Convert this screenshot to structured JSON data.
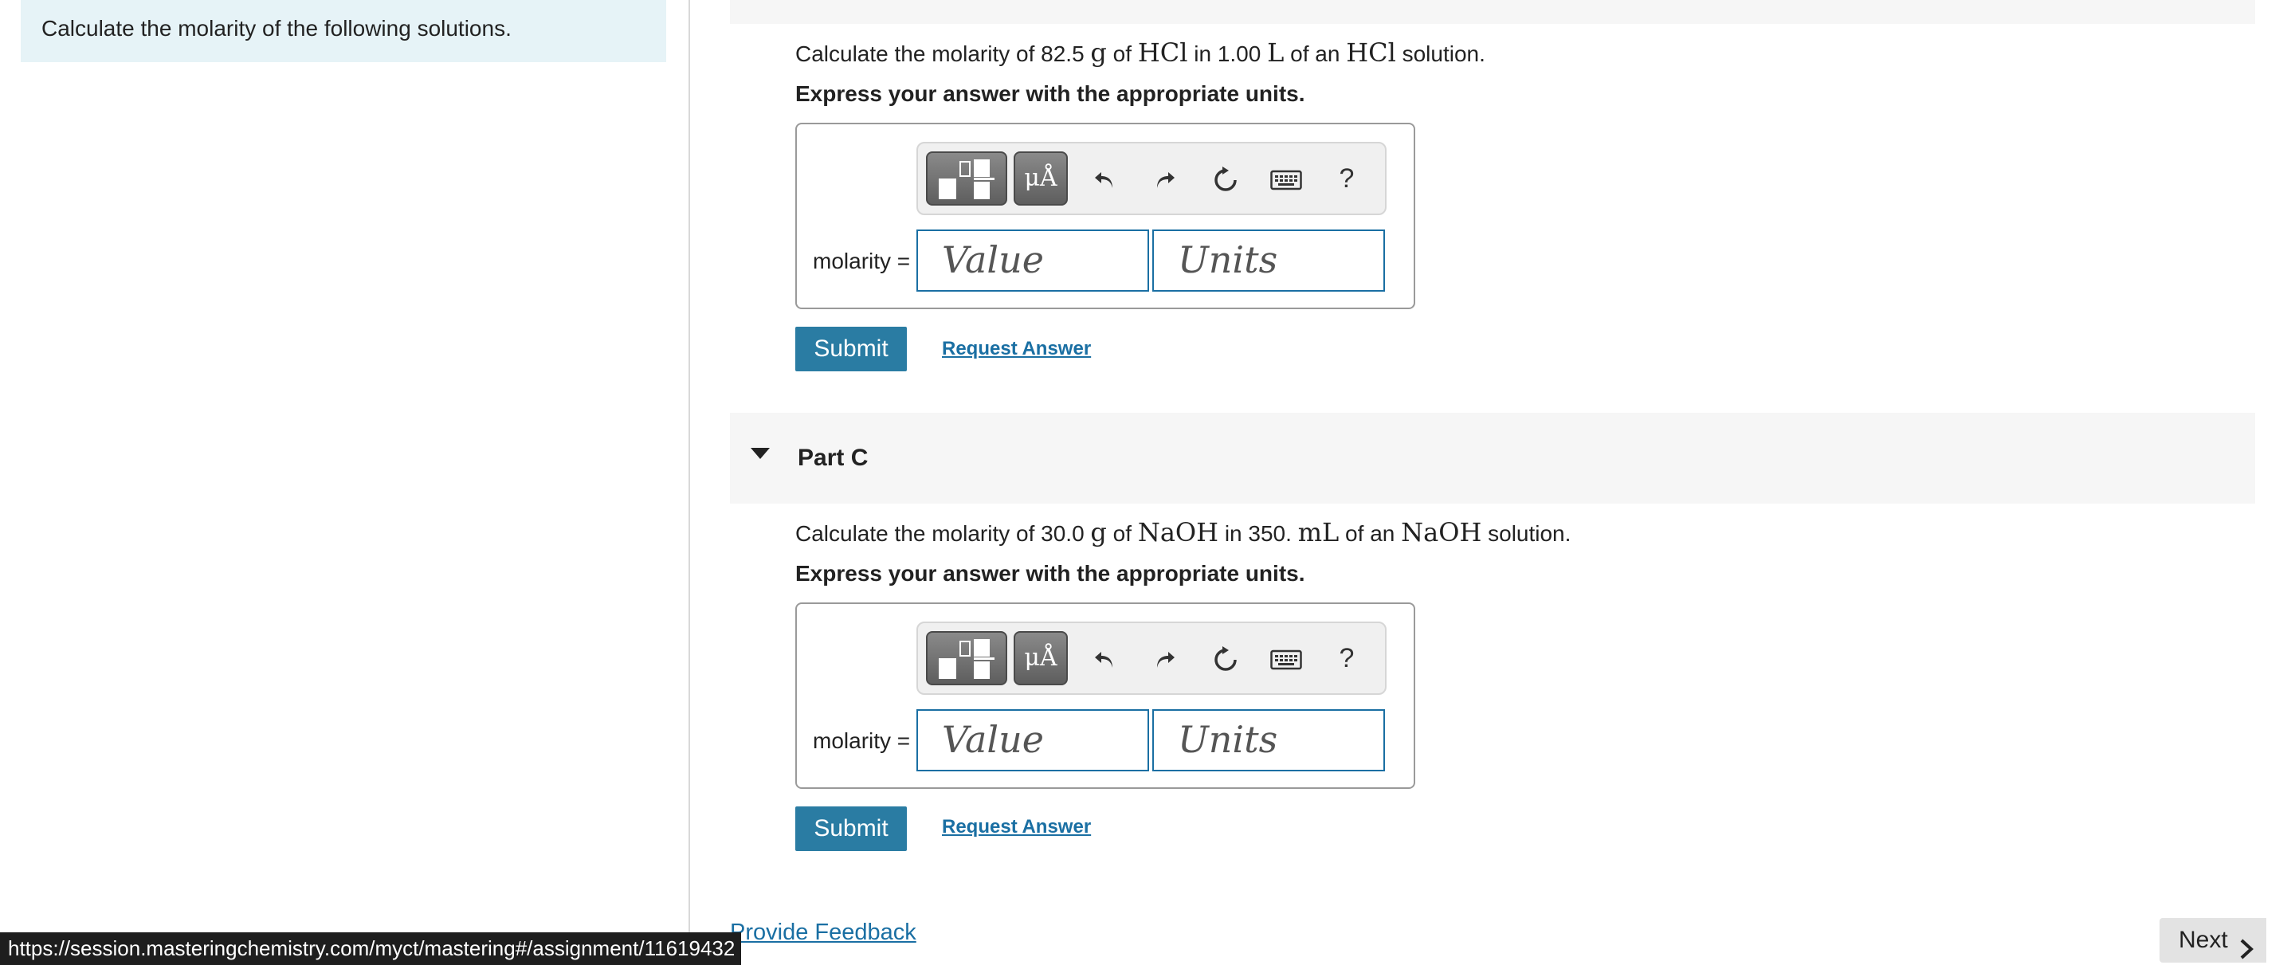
{
  "instructions": "Calculate the molarity of the following solutions.",
  "part_b": {
    "question": {
      "prefix": "Calculate the molarity of ",
      "mass": "82.5",
      "mass_unit": "g",
      "of1": " of ",
      "solute": "HCl",
      "in": " in ",
      "volume": "1.00",
      "volume_unit": "L",
      "of2": " of an ",
      "solute2": "HCl",
      "suffix": " solution."
    },
    "express": "Express your answer with the appropriate units.",
    "label": "molarity =",
    "value_placeholder": "Value",
    "units_placeholder": "Units",
    "submit": "Submit",
    "request": "Request Answer"
  },
  "part_c": {
    "title": "Part C",
    "question": {
      "prefix": "Calculate the molarity of ",
      "mass": "30.0",
      "mass_unit": "g",
      "of1": " of ",
      "solute": "NaOH",
      "in": " in ",
      "volume": "350.",
      "volume_unit": "mL",
      "of2": " of an ",
      "solute2": "NaOH",
      "suffix": " solution."
    },
    "express": "Express your answer with the appropriate units.",
    "label": "molarity =",
    "value_placeholder": "Value",
    "units_placeholder": "Units",
    "submit": "Submit",
    "request": "Request Answer"
  },
  "toolbar": {
    "units_symbol": "μÅ",
    "help": "?",
    "icons": [
      "templates-icon",
      "units-icon",
      "undo-icon",
      "redo-icon",
      "reset-icon",
      "keyboard-icon",
      "help-icon"
    ]
  },
  "footer": {
    "feedback": "Provide Feedback",
    "next": "Next"
  },
  "status_url": "https://session.masteringchemistry.com/myct/mastering#/assignment/11619432",
  "colors": {
    "accent": "#2a7ca3",
    "link": "#1a6fa3",
    "instruction_bg": "#e6f3f7",
    "header_bg": "#f6f6f6"
  }
}
